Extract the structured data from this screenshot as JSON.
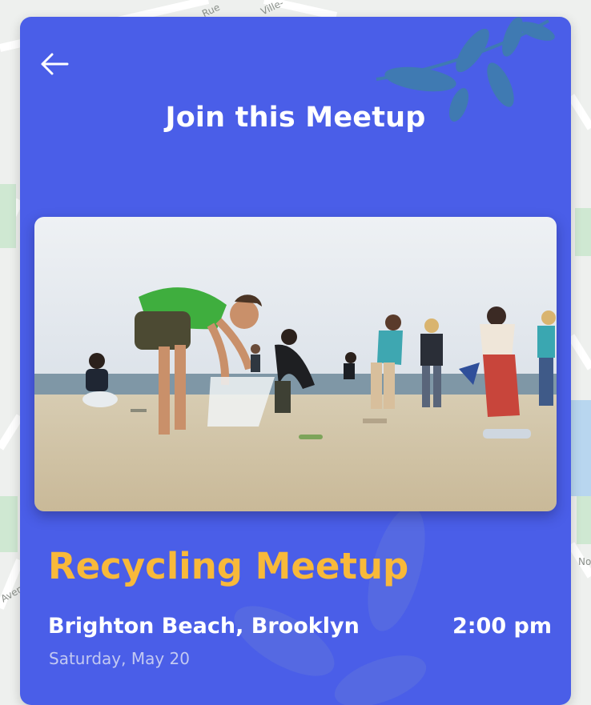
{
  "map": {
    "street_labels": [
      "Rue",
      "Ville-",
      "Aven",
      "No"
    ]
  },
  "header": {
    "back_icon": "arrow-left-icon",
    "title": "Join this Meetup"
  },
  "event": {
    "photo_icon": "beach-cleanup-photo",
    "name": "Recycling Meetup",
    "location": "Brighton Beach, Brooklyn",
    "time": "2:00 pm",
    "date": "Saturday, May 20"
  },
  "colors": {
    "card_background": "#4a5ee8",
    "event_name": "#f8b93a",
    "text": "#ffffff",
    "date_text": "#c3c9f2",
    "leaf": "#3e7fa8"
  }
}
